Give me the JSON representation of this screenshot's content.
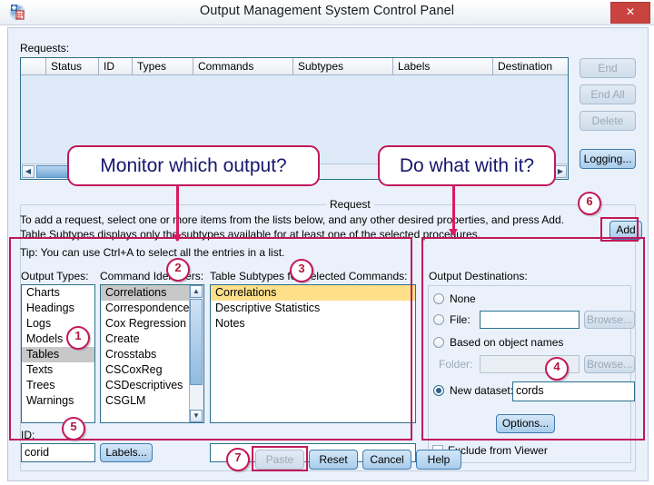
{
  "window": {
    "title": "Output Management System Control Panel",
    "app_icon": "spss-icon",
    "close_label": "✕"
  },
  "requests": {
    "label": "Requests:",
    "columns": [
      "",
      "Status",
      "ID",
      "Types",
      "Commands",
      "Subtypes",
      "Labels",
      "Destination"
    ],
    "rows": [],
    "scroll": {
      "left_arrow": "◀",
      "right_arrow": "▶"
    }
  },
  "side_buttons": [
    {
      "label": "End",
      "enabled": false
    },
    {
      "label": "End All",
      "enabled": false
    },
    {
      "label": "Delete",
      "enabled": false
    },
    {
      "label": "Logging...",
      "enabled": true
    }
  ],
  "group": {
    "legend": "Request"
  },
  "instructions": [
    "To add a request, select one or more items from the lists below, and any other desired properties, and press Add.",
    "Table Subtypes displays only the subtypes available for at least one of the selected procedures.",
    "Tip: You can use Ctrl+A to select all the entries in a list."
  ],
  "add_button": {
    "label": "Add",
    "enabled": true
  },
  "output_types": {
    "title": "Output Types:",
    "items": [
      "Charts",
      "Headings",
      "Logs",
      "Models",
      "Tables",
      "Texts",
      "Trees",
      "Warnings"
    ],
    "selected": "Tables"
  },
  "command_identifiers": {
    "title": "Command Identifiers:",
    "items": [
      "Correlations",
      "Correspondence",
      "Cox Regression",
      "Create",
      "Crosstabs",
      "CSCoxReg",
      "CSDescriptives",
      "CSGLM"
    ],
    "selected": "Correlations"
  },
  "table_subtypes": {
    "title": "Table Subtypes for Selected Commands:",
    "items": [
      "Correlations",
      "Descriptive Statistics",
      "Notes"
    ],
    "selected": "Correlations"
  },
  "id_section": {
    "label": "ID:",
    "value": "corid",
    "labels_button": "Labels...",
    "extra_field_value": ""
  },
  "output_destinations": {
    "title": "Output Destinations:",
    "options": [
      {
        "label": "None",
        "selected": false
      },
      {
        "label": "File:",
        "selected": false
      },
      {
        "label": "Based on object names",
        "selected": false
      },
      {
        "label": "New dataset:",
        "selected": true
      }
    ],
    "file_value": "",
    "file_browse": "Browse...",
    "folder_label": "Folder:",
    "folder_value": "",
    "folder_browse": "Browse...",
    "new_dataset_value": "cords",
    "options_button": "Options...",
    "exclude_checkbox": {
      "label": "Exclude from Viewer",
      "checked": false
    }
  },
  "footer_buttons": [
    {
      "label": "Paste",
      "enabled": false
    },
    {
      "label": "Reset",
      "enabled": true
    },
    {
      "label": "Cancel",
      "enabled": true
    },
    {
      "label": "Help",
      "enabled": true
    }
  ],
  "annotations": {
    "callouts": [
      {
        "text": "Monitor which output?"
      },
      {
        "text": "Do what with it?"
      }
    ],
    "badges": [
      "1",
      "2",
      "3",
      "4",
      "5",
      "6",
      "7"
    ],
    "accent_color": "#c2185b",
    "callout_text_color": "#16166e"
  },
  "colors": {
    "dialog_bg": "#eaf1fb",
    "titlebar_bg": "#f3f6fa",
    "close_bg": "#c9443f",
    "selection_grey": "#c8c8c8",
    "selection_amber": "#ffe08a",
    "list_border": "#2c6f8c",
    "button_blue": "#a9cdec"
  }
}
